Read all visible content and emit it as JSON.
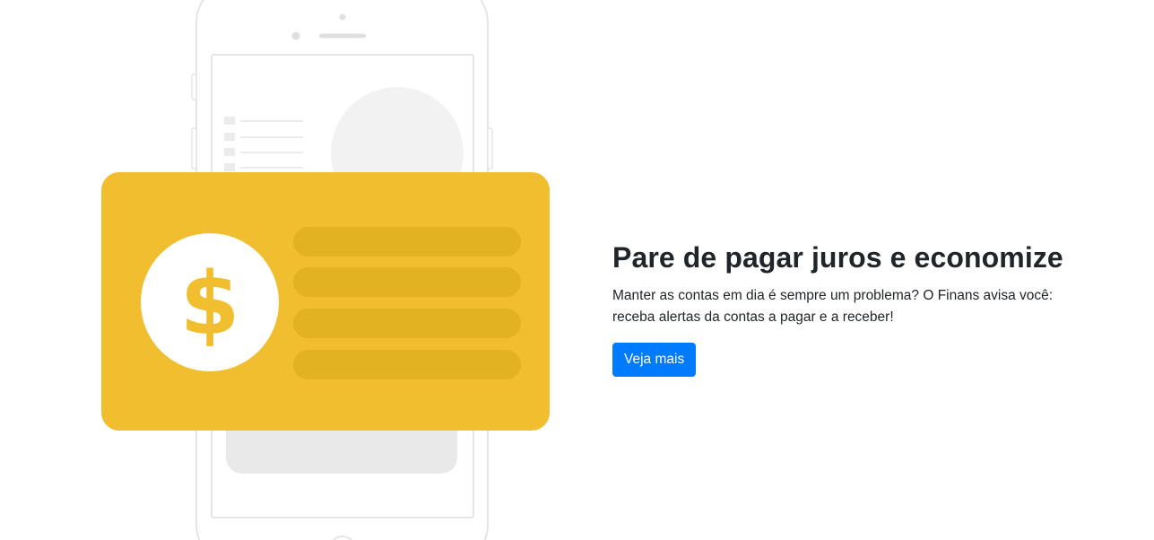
{
  "illustration": {
    "icon": "dollar-sign-icon",
    "symbol": "$",
    "card_color": "#f0be2f",
    "row_color": "#e2b223"
  },
  "hero": {
    "title": "Pare de pagar juros e economize",
    "description": "Manter as contas em dia é sempre um problema? O Finans avisa você: receba alertas da contas a pagar e a receber!",
    "button_label": "Veja mais"
  },
  "colors": {
    "primary": "#007bff",
    "text": "#212529"
  }
}
